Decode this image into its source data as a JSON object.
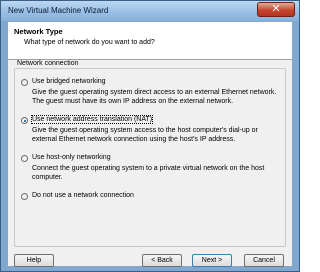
{
  "window": {
    "title": "New Virtual Machine Wizard",
    "close_glyph": "✕"
  },
  "header": {
    "title": "Network Type",
    "subtitle": "What type of network do you want to add?"
  },
  "group": {
    "label": "Network connection"
  },
  "options": [
    {
      "label": "Use bridged networking",
      "description": "Give the guest operating system direct access to an external Ethernet network. The guest must have its own IP address on the external network.",
      "selected": false
    },
    {
      "label": "Use network address translation (NAT)",
      "description": "Give the guest operating system access to the host computer's dial-up or external Ethernet network connection using the host's IP address.",
      "selected": true
    },
    {
      "label": "Use host-only networking",
      "description": "Connect the guest operating system to a private virtual network on the host computer.",
      "selected": false
    },
    {
      "label": "Do not use a network connection",
      "description": "",
      "selected": false
    }
  ],
  "buttons": {
    "help": "Help",
    "back": "< Back",
    "next": "Next >",
    "cancel": "Cancel"
  }
}
